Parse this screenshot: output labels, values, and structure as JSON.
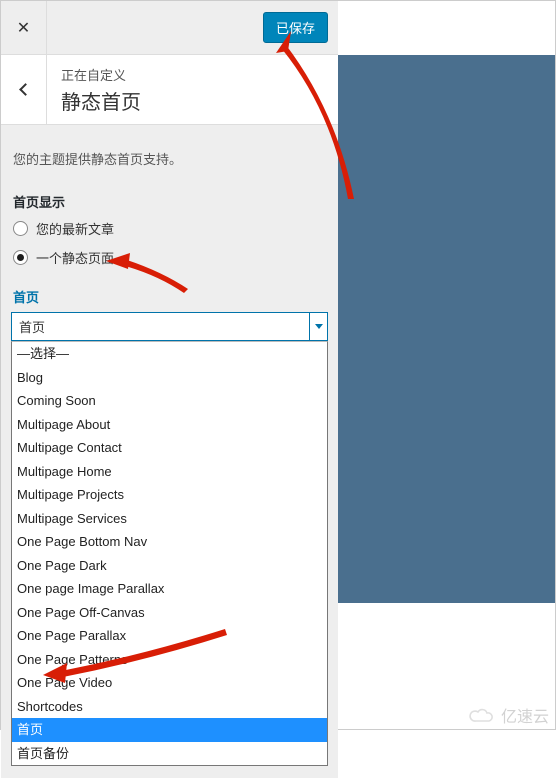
{
  "topbar": {
    "save_label": "已保存"
  },
  "header": {
    "customizing_label": "正在自定义",
    "section_title": "静态首页"
  },
  "note": "您的主题提供静态首页支持。",
  "front_display": {
    "group_label": "首页显示",
    "option_latest": "您的最新文章",
    "option_static": "一个静态页面",
    "selected": "static"
  },
  "front_page": {
    "label": "首页",
    "selected_value": "首页",
    "options": [
      "—选择—",
      "Blog",
      "Coming Soon",
      "Multipage About",
      "Multipage Contact",
      "Multipage Home",
      "Multipage Projects",
      "Multipage Services",
      "One Page Bottom Nav",
      "One Page Dark",
      "One page Image Parallax",
      "One Page Off-Canvas",
      "One Page Parallax",
      "One Page Patterns",
      "One Page Video",
      "Shortcodes",
      "首页",
      "首页备份"
    ],
    "highlight_index": 16
  },
  "watermark": "亿速云"
}
